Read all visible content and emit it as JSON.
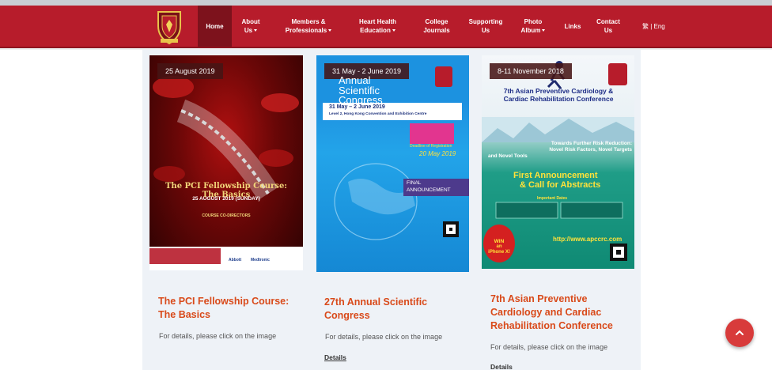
{
  "nav": {
    "items": [
      {
        "label": "Home",
        "lines": [
          "Home"
        ],
        "active": true
      },
      {
        "label": "About Us",
        "lines": [
          "About",
          "Us"
        ],
        "dropdown": true
      },
      {
        "label": "Members & Professionals",
        "lines": [
          "Members &",
          "Professionals"
        ],
        "dropdown": true
      },
      {
        "label": "Heart Health Education",
        "lines": [
          "Heart Health",
          "Education"
        ],
        "dropdown": true
      },
      {
        "label": "College Journals",
        "lines": [
          "College",
          "Journals"
        ]
      },
      {
        "label": "Supporting Us",
        "lines": [
          "Supporting",
          "Us"
        ]
      },
      {
        "label": "Photo Album",
        "lines": [
          "Photo",
          "Album"
        ],
        "dropdown": true
      },
      {
        "label": "Links",
        "lines": [
          "Links"
        ]
      },
      {
        "label": "Contact Us",
        "lines": [
          "Contact",
          "Us"
        ]
      }
    ],
    "language": "繁 | Eng"
  },
  "cards": [
    {
      "date": "25 August 2019",
      "poster_title": "The PCI Fellowship Course: The Basics",
      "poster_date": "25 AUGUST 2019 (SUNDAY)",
      "poster_directors": "COURSE CO-DIRECTORS",
      "poster_sponsors": [
        "Abbott",
        "Medtronic"
      ],
      "title": "The PCI Fellowship Course: The Basics",
      "title_lines": [
        "The PCI Fellowship Course:",
        "The Basics"
      ],
      "desc": "For details, please click on the image",
      "link": ""
    },
    {
      "date": "31 May - 2 June 2019",
      "poster_heading": [
        "Annual",
        "Scientific",
        "Congress"
      ],
      "poster_dates": "31 May – 2 June 2019",
      "poster_venue": "Level 2, Hong Kong Convention and Exhibition Centre",
      "poster_deadline_label": "Deadline of Registration",
      "poster_deadline": "20 May 2019",
      "poster_announcement": [
        "FINAL",
        "ANNOUNCEMENT"
      ],
      "title": "27th Annual Scientific Congress",
      "title_lines": [
        "27th Annual Scientific",
        "Congress"
      ],
      "desc": "For details, please click on the image",
      "link": "Details"
    },
    {
      "date": "8-11 November 2018",
      "poster_heading": [
        "7th Asian Preventive Cardiology &",
        "Cardiac Rehabilitation Conference"
      ],
      "poster_sub": [
        "Towards Further Risk Reduction:",
        "Novel Risk Factors, Novel Targets",
        "and Novel Tools"
      ],
      "poster_announce": [
        "First Announcement",
        "& Call for Abstracts"
      ],
      "poster_dates_label": "Important Dates",
      "poster_url": "http://www.apccrc.com",
      "poster_prize": [
        "WIN",
        "an",
        "iPhone X!"
      ],
      "title": "7th Asian Preventive Cardiology and Cardiac Rehabilitation Conference",
      "title_lines": [
        "7th Asian Preventive",
        "Cardiology and Cardiac",
        "Rehabilitation Conference"
      ],
      "desc": "For details, please click on the image",
      "link": "Details"
    }
  ],
  "colors": {
    "brand_red": "#b71c2b",
    "active_nav": "#7d121c",
    "title_orange": "#d94a1a",
    "fab": "#d83b3b"
  },
  "icons": {
    "logo": "college-crest-logo",
    "fab": "chevron-up-icon"
  }
}
